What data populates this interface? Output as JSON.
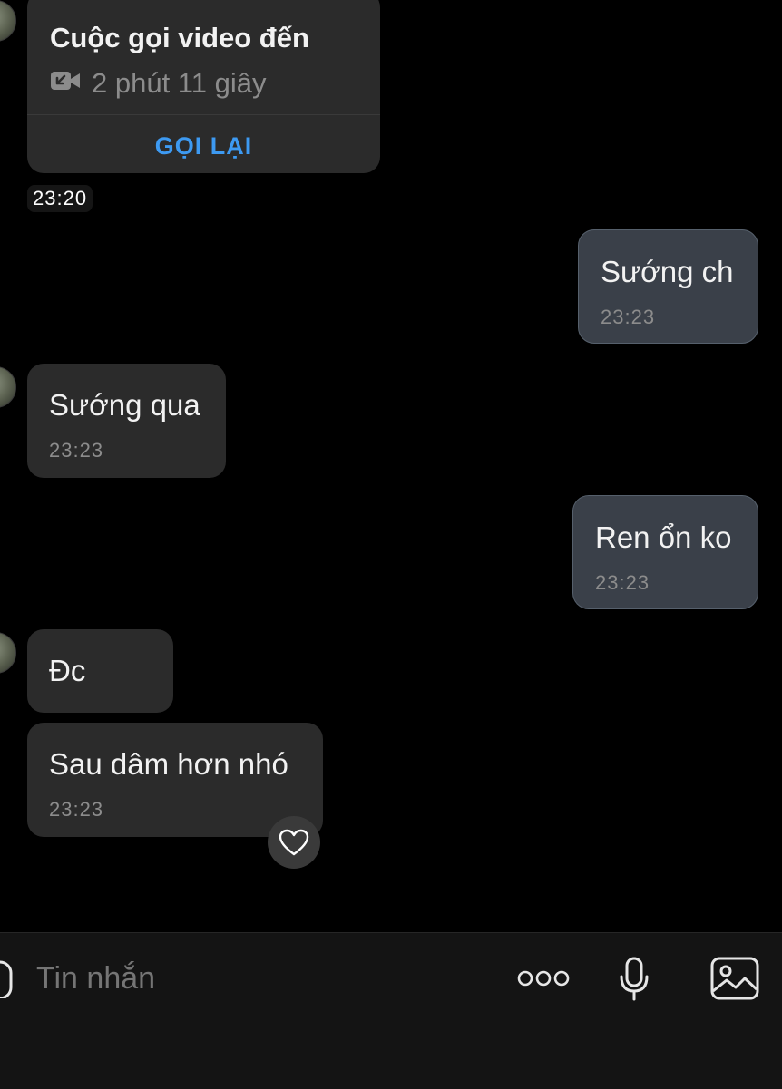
{
  "call": {
    "title": "Cuộc gọi video đến",
    "duration": "2 phút 11 giây",
    "callback_label": "GỌI LẠI",
    "icon": "video-camera-incoming-icon",
    "time": "23:20"
  },
  "messages": [
    {
      "direction": "outgoing",
      "text": "Sướng ch",
      "time": "23:23"
    },
    {
      "direction": "incoming",
      "text": "Sướng qua",
      "time": "23:23"
    },
    {
      "direction": "outgoing",
      "text": "Ren ổn ko",
      "time": "23:23"
    },
    {
      "direction": "incoming",
      "text": "Đc",
      "time": ""
    },
    {
      "direction": "incoming",
      "text": "Sau dâm hơn nhó",
      "time": "23:23"
    }
  ],
  "reaction": {
    "icon": "heart-outline-icon"
  },
  "composer": {
    "placeholder": "Tin nhắn",
    "icons": [
      "sticker-icon",
      "more-dots-icon",
      "microphone-icon",
      "image-icon"
    ]
  },
  "colors": {
    "background": "#000000",
    "incoming_bubble": "#2b2b2b",
    "outgoing_bubble": "#3a4049",
    "accent": "#3d9af2",
    "timestamp": "#8c8c8c"
  }
}
